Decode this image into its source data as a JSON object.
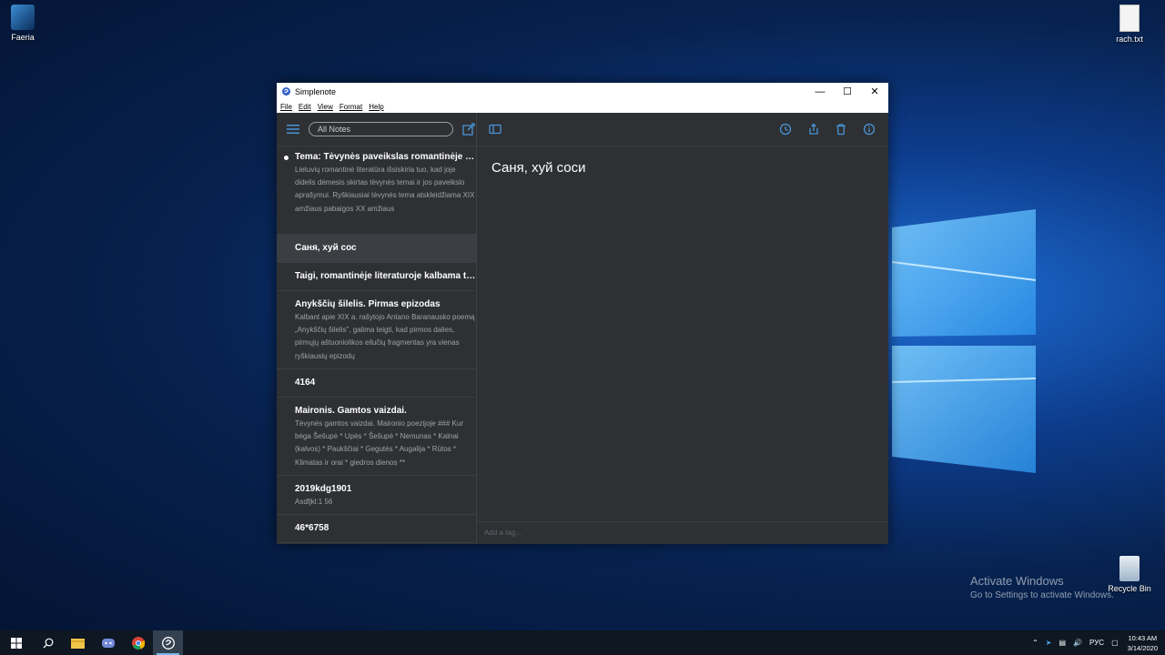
{
  "desktop": {
    "icons": [
      {
        "label": "Faeria"
      },
      {
        "label": "rach.txt"
      },
      {
        "label": "Recycle Bin"
      }
    ],
    "activation": {
      "title": "Activate Windows",
      "subtitle": "Go to Settings to activate Windows."
    }
  },
  "window": {
    "title": "Simplenote",
    "menu": [
      "File",
      "Edit",
      "View",
      "Format",
      "Help"
    ]
  },
  "sidebar": {
    "search_placeholder": "All Notes",
    "notes": [
      {
        "title": "Tema: Tėvynės paveikslas romantinėje lie...",
        "preview": "Lietuvių romantinė literatūra išsiskiria tuo, kad joje didelis dėmesis skirtas tėvynės temai ir jos paveikslo aprašymui. Ryškiausiai tėvynės tema atskleidžiama XIX amžiaus pabaigos XX amžiaus",
        "pinned": true
      },
      {
        "title": "Саня, хуй сос",
        "preview": "",
        "selected": true
      },
      {
        "title": "Taigi, romantinėje literaturoje kalbama tr...",
        "preview": ""
      },
      {
        "title": "Anykščių šilelis. Pirmas epizodas",
        "preview": "Kalbant apie XIX a. rašytojo Antano Baranausko poemą „Anykščių šilelis\", galima teigti, kad pirmos dalies, pirmųjų aštuoniolikos eilučių fragmentas yra vienas ryškiausių epizodų"
      },
      {
        "title": "4164",
        "preview": ""
      },
      {
        "title": "Maironis. Gamtos vaizdai.",
        "preview": "Tėvynės gamtos vaizdai. Maironio poezijoje ### Kur bėga Šešupė * Upės * Šešupė * Nemunas * Kalnai (kalvos) * Paukščiai * Gegutės * Augalija * Rūtos * Klimatas ir orai * giedros dienos **"
      },
      {
        "title": "2019kdg1901",
        "preview": "Asdfjkl:1 56"
      },
      {
        "title": "46*6758",
        "preview": ""
      }
    ]
  },
  "editor": {
    "content": "Саня, хуй соси",
    "tag_placeholder": "Add a tag..."
  },
  "taskbar": {
    "lang": "РУС",
    "time": "10:43 AM",
    "date": "3/14/2020"
  },
  "colors": {
    "accent": "#4895d9",
    "panel": "#2e3033",
    "selected": "#3b3e42"
  }
}
